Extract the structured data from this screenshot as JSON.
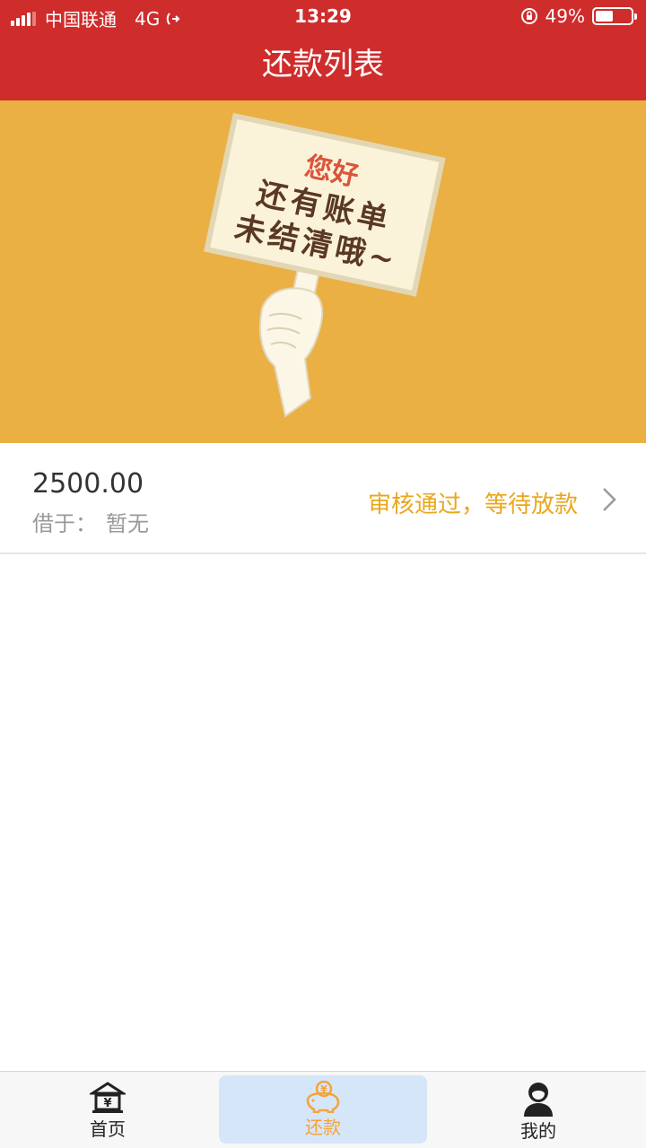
{
  "status_bar": {
    "carrier": "中国联通",
    "network": "4G",
    "time": "13:29",
    "battery": "49%",
    "battery_level": 0.49
  },
  "nav": {
    "title": "还款列表"
  },
  "banner": {
    "sign_line1": "您好",
    "sign_line2": "还有账单",
    "sign_line3": "未结清哦~"
  },
  "records": [
    {
      "amount": "2500.00",
      "lender_label": "借于：",
      "lender_value": "暂无",
      "status": "审核通过，等待放款"
    }
  ],
  "tab_bar": {
    "items": [
      {
        "label": "首页",
        "icon": "bank-icon"
      },
      {
        "label": "还款",
        "icon": "piggy-bank-icon"
      },
      {
        "label": "我的",
        "icon": "user-icon"
      }
    ],
    "active_index": 1
  },
  "colors": {
    "brand_red": "#cf2c2c",
    "banner_orange": "#ebb043",
    "status_orange": "#e8a71c",
    "active_tab": "#f5a33a"
  }
}
